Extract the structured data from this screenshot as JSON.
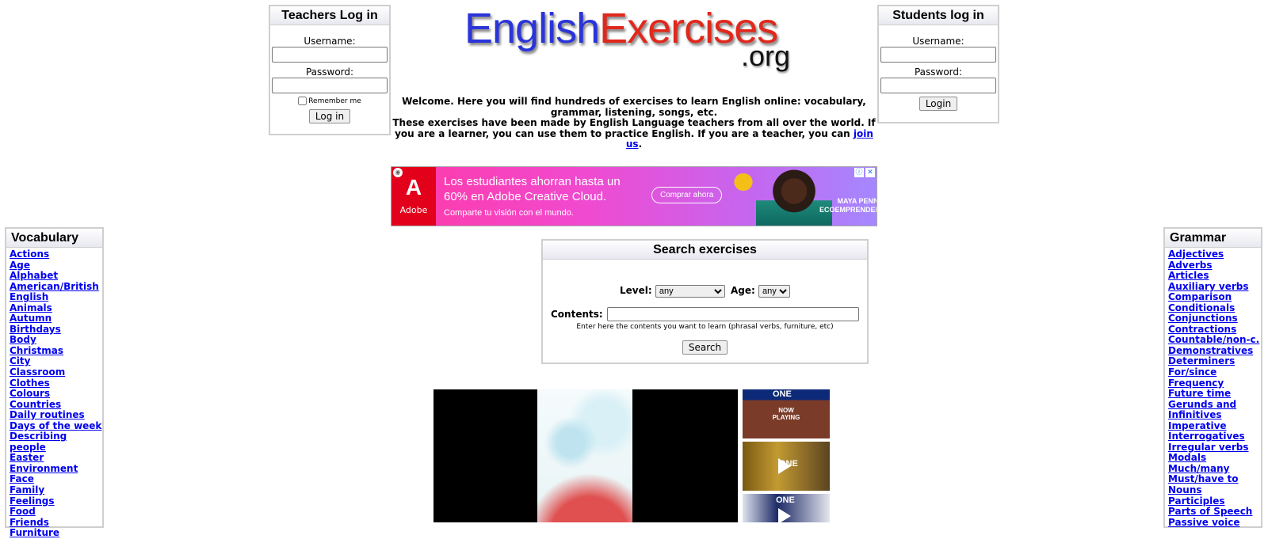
{
  "teachers_login": {
    "title": "Teachers Log in",
    "username_label": "Username:",
    "password_label": "Password:",
    "remember_label": "Remember me",
    "button_label": "Log in"
  },
  "students_login": {
    "title": "Students log in",
    "username_label": "Username:",
    "password_label": "Password:",
    "button_label": "Login"
  },
  "logo": {
    "part1": "English",
    "part2": "Exercises",
    "domain": ".org",
    "color_blue": "#2a34d8",
    "color_red": "#e0281c"
  },
  "welcome": {
    "line1": "Welcome. Here you will find hundreds of exercises to learn English online: vocabulary, grammar, listening, songs, etc.",
    "line2_prefix": "These exercises have been made by English Language teachers from all over the world. If you are a learner, you can use them to practice English. If you are a teacher, you can ",
    "join_link": "join us",
    "line2_suffix": "."
  },
  "ad": {
    "brand": "Adobe",
    "brand_mark": "A",
    "headline_line1": "Los estudiantes ahorran hasta un",
    "headline_line2": "60% en Adobe Creative Cloud.",
    "subline": "Comparte tu visión con el mundo.",
    "cta": "Comprar ahora",
    "person_name": "MAYA PENN",
    "person_title": "ECOEMPRENDEDORA"
  },
  "vocabulary": {
    "title": "Vocabulary",
    "items": [
      "Actions",
      "Age",
      "Alphabet",
      "American/British English",
      "Animals",
      "Autumn",
      "Birthdays",
      "Body",
      "Christmas",
      "City",
      "Classroom",
      "Clothes",
      "Colours",
      "Countries",
      "Daily routines",
      "Days of the week",
      "Describing people",
      "Easter",
      "Environment",
      "Face",
      "Family",
      "Feelings",
      "Food",
      "Friends",
      "Furniture"
    ]
  },
  "grammar": {
    "title": "Grammar",
    "items": [
      "Adjectives",
      "Adverbs",
      "Articles",
      "Auxiliary verbs",
      "Comparison",
      "Conditionals",
      "Conjunctions",
      "Contractions",
      "Countable/non-c.",
      "Demonstratives",
      "Determiners",
      "For/since",
      "Frequency",
      "Future time",
      "Gerunds and Infinitives",
      "Imperative",
      "Interrogatives",
      "Irregular verbs",
      "Modals",
      "Much/many",
      "Must/have to",
      "Nouns",
      "Participles",
      "Parts of Speech",
      "Passive voice"
    ]
  },
  "search": {
    "title": "Search exercises",
    "level_label": "Level:",
    "level_value": "any",
    "age_label": "Age:",
    "age_value": "any",
    "contents_label": "Contents:",
    "hint": "Enter here the contents you want to learn (phrasal verbs, furniture, etc)",
    "button_label": "Search"
  },
  "video": {
    "thumb1_logo": "ONE",
    "thumb1_label_line1": "NOW",
    "thumb1_label_line2": "PLAYING",
    "thumb2_logo": "ONE",
    "thumb3_logo": "ONE"
  }
}
